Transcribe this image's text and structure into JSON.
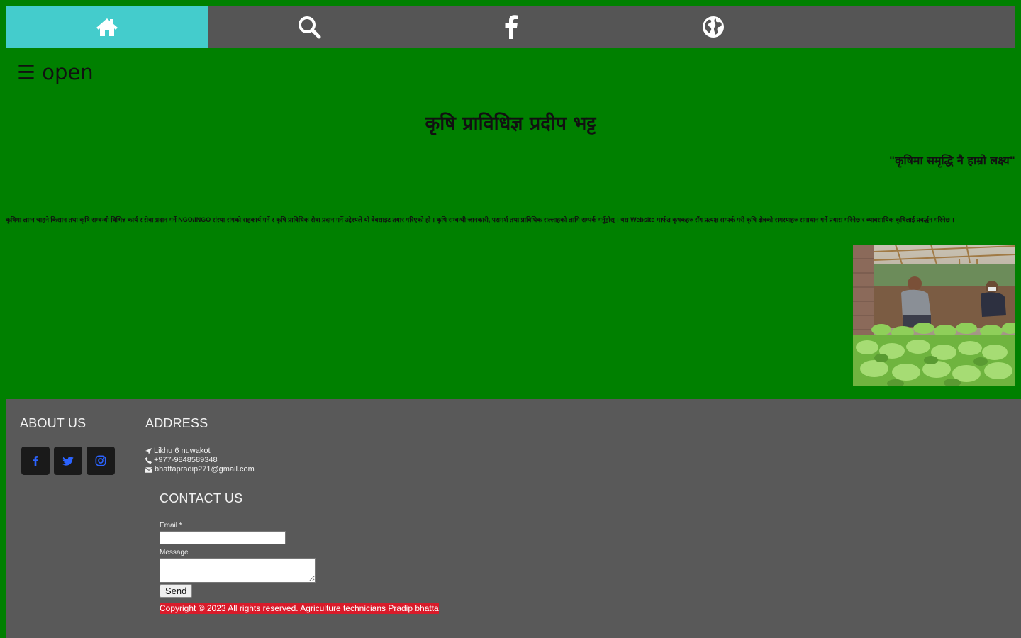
{
  "nav": {
    "items": [
      {
        "icon": "home-icon",
        "active": true
      },
      {
        "icon": "search-icon",
        "active": false
      },
      {
        "icon": "facebook-icon",
        "active": false
      },
      {
        "icon": "globe-icon",
        "active": false
      }
    ],
    "active_color": "#44cccc",
    "bar_color": "#555555"
  },
  "sidebar_toggle": {
    "label": "☰ open"
  },
  "hero": {
    "title": "कृषि प्राविधिज्ञ प्रदीप भट्ट",
    "quote": "\"कृषिमा समृद्धि नै हाम्रो लक्ष्य\"",
    "description": "कृषिमा लाग्न चाहने किसान तथा कृषि सम्बन्धी विभिन्न कार्य र सेवा प्रदान गर्ने NGO/INGO संस्था संगको सहकार्य गर्ने र कृषि प्राविधिक सेवा प्रदान गर्ने उद्देश्यले यो वेबसाइट तयार गरिएको हो । कृषि सम्बन्धी जानकारी, परामर्श तथा प्राविधिक सल्लाहको लागि सम्पर्क गर्नुहोस् । यस Website मार्फत कृषकहरु सँग प्रत्यक्ष सम्पर्क गरी कृषि क्षेत्रको समस्याहरु समाधान गर्ने प्रयास गरिनेछ र व्यावसायिक कृषिलाई प्रवर्द्धन गरिनेछ ।",
    "photo_alt": "greenhouse seedlings photo",
    "bg_color": "#008000"
  },
  "footer": {
    "about_heading": "ABOUT US",
    "address_heading": "ADDRESS",
    "contact_heading": "CONTACT US",
    "social": [
      {
        "icon": "facebook-icon"
      },
      {
        "icon": "twitter-icon"
      },
      {
        "icon": "instagram-icon"
      }
    ],
    "address": {
      "location": "Likhu 6 nuwakot",
      "phone": "+977-9848589348",
      "email": "bhattapradip271@gmail.com"
    },
    "form": {
      "email_label": "Email *",
      "message_label": "Message",
      "send_label": "Send"
    },
    "copyright": "Copyright © 2023 All rights reserved. Agriculture technicians Pradip bhatta",
    "bg_color": "#595959",
    "copyright_bg": "#d81b2a"
  }
}
